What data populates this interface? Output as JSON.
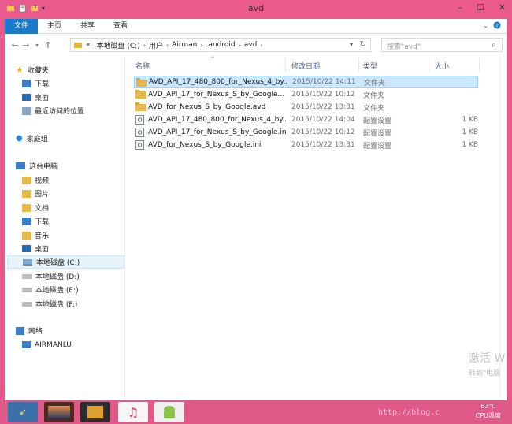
{
  "window": {
    "title": "avd"
  },
  "ribbon": {
    "tabs": [
      "文件",
      "主页",
      "共享",
      "查看"
    ]
  },
  "address": {
    "prefix": "«",
    "segments": [
      "本地磁盘 (C:)",
      "用户",
      "Airman",
      ".android",
      "avd"
    ]
  },
  "search": {
    "placeholder": "搜索\"avd\""
  },
  "nav": {
    "favorites": {
      "label": "收藏夹",
      "items": [
        "下载",
        "桌面",
        "最近访问的位置"
      ]
    },
    "homegroup": {
      "label": "家庭组"
    },
    "thispc": {
      "label": "这台电脑",
      "items": [
        "视频",
        "图片",
        "文档",
        "下载",
        "音乐",
        "桌面",
        "本地磁盘 (C:)",
        "本地磁盘 (D:)",
        "本地磁盘 (E:)",
        "本地磁盘 (F:)"
      ]
    },
    "network": {
      "label": "网络",
      "items": [
        "AIRMANLU"
      ]
    }
  },
  "columns": {
    "name": "名称",
    "date": "修改日期",
    "type": "类型",
    "size": "大小"
  },
  "files": [
    {
      "name": "AVD_API_17_480_800_for_Nexus_4_by...",
      "date": "2015/10/22 14:11",
      "type": "文件夹",
      "size": "",
      "kind": "folder"
    },
    {
      "name": "AVD_API_17_for_Nexus_S_by_Google...",
      "date": "2015/10/22 10:12",
      "type": "文件夹",
      "size": "",
      "kind": "folder"
    },
    {
      "name": "AVD_for_Nexus_S_by_Google.avd",
      "date": "2015/10/22 13:31",
      "type": "文件夹",
      "size": "",
      "kind": "folder"
    },
    {
      "name": "AVD_API_17_480_800_for_Nexus_4_by...",
      "date": "2015/10/22 14:04",
      "type": "配置设置",
      "size": "1 KB",
      "kind": "ini"
    },
    {
      "name": "AVD_API_17_for_Nexus_S_by_Google.ini",
      "date": "2015/10/22 10:12",
      "type": "配置设置",
      "size": "1 KB",
      "kind": "ini"
    },
    {
      "name": "AVD_for_Nexus_S_by_Google.ini",
      "date": "2015/10/22 13:31",
      "type": "配置设置",
      "size": "1 KB",
      "kind": "ini"
    }
  ],
  "watermark": {
    "line1": "激活 W",
    "line2": "转到\"电脑"
  },
  "taskbar": {
    "temp": "62℃",
    "temp_label": "CPU温度",
    "overlay": "http://blog.c"
  },
  "colors": {
    "accent": "#1979ca",
    "frame": "#ea5a8c",
    "selection": "#cce8ff",
    "folder": "#e8b94a"
  }
}
